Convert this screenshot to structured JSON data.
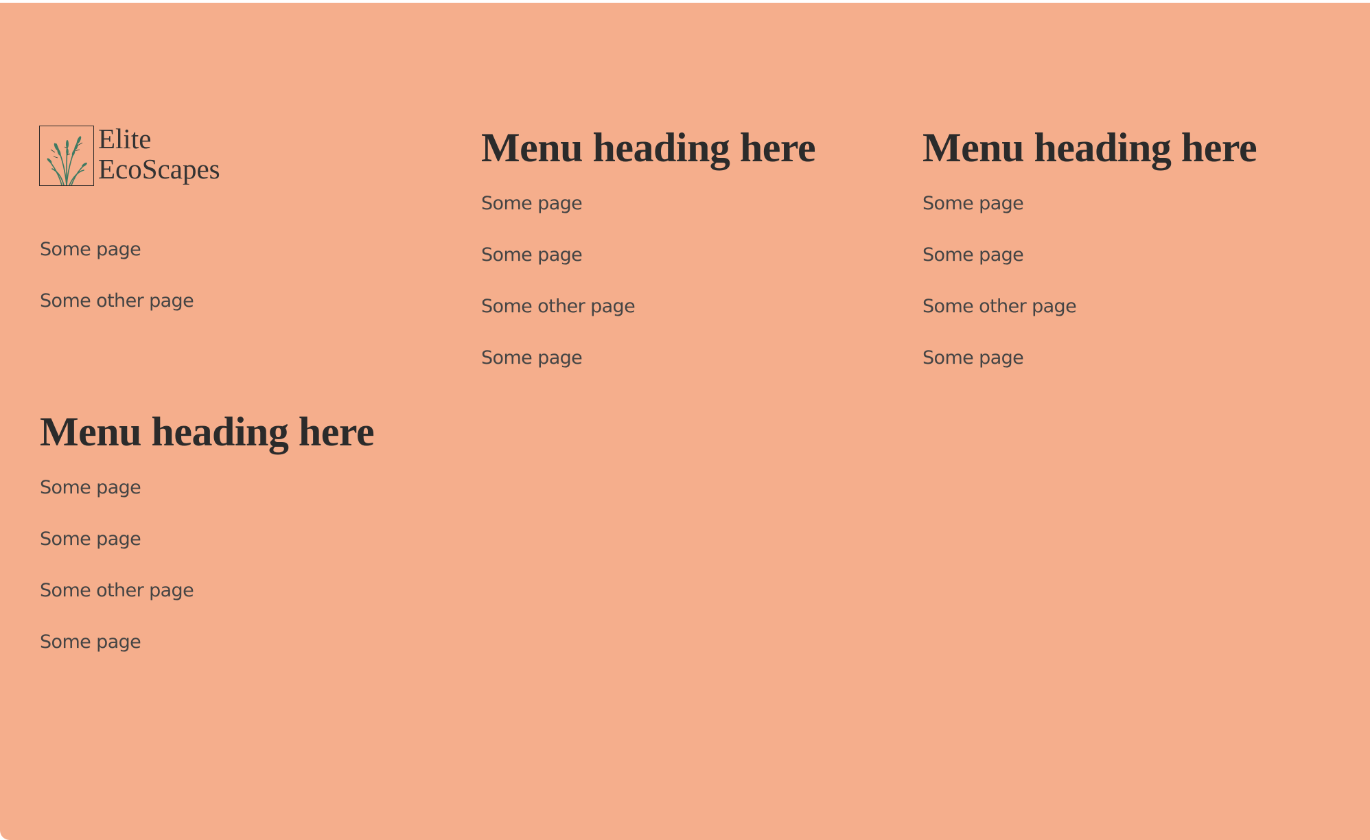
{
  "brand": {
    "line1": "Elite",
    "line2": "EcoScapes",
    "logo_icon": "reed-grass-icon"
  },
  "brand_links": [
    {
      "label": "Some page"
    },
    {
      "label": "Some other page"
    }
  ],
  "menus": [
    {
      "heading": "Menu heading here",
      "items": [
        {
          "label": "Some page"
        },
        {
          "label": "Some page"
        },
        {
          "label": "Some other page"
        },
        {
          "label": "Some page"
        }
      ]
    },
    {
      "heading": "Menu heading here",
      "items": [
        {
          "label": "Some page"
        },
        {
          "label": "Some page"
        },
        {
          "label": "Some other page"
        },
        {
          "label": "Some page"
        }
      ]
    },
    {
      "heading": "Menu heading here",
      "items": [
        {
          "label": "Some page"
        },
        {
          "label": "Some page"
        },
        {
          "label": "Some other page"
        },
        {
          "label": "Some page"
        }
      ]
    }
  ],
  "colors": {
    "background": "#f5ae8c",
    "text": "#444444",
    "heading": "#2b2b2b",
    "logo_green": "#3f7a62"
  }
}
